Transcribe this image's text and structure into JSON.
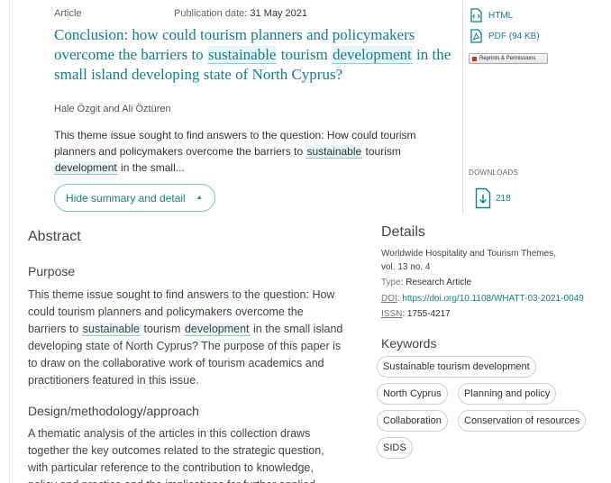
{
  "article": {
    "type": "Article",
    "pub_date_label": "Publication date:",
    "pub_date": "31 May 2021",
    "title_parts": [
      "Conclusion: how could tourism planners and policymakers overcome the barriers to ",
      "sustainable",
      " tourism ",
      "development",
      " in the small island developing state of North Cyprus?"
    ],
    "authors": "Hale Özgit and Ali Öztüren",
    "snippet_parts": [
      "This theme issue sought to find answers to the question: How could tourism planners and policymakers overcome the barriers to ",
      "sustainable",
      " tourism ",
      "development",
      " in the small..."
    ],
    "toggle_label": "Hide summary and detail"
  },
  "sidebar": {
    "html_label": "HTML",
    "pdf_label": "PDF (94 KB)",
    "reprints_label": "Reprints & Permissions",
    "downloads_label": "DOWNLOADS",
    "downloads_count": "218"
  },
  "abstract": {
    "heading": "Abstract",
    "purpose_heading": "Purpose",
    "purpose_parts": [
      "This theme issue sought to find answers to the question: How could tourism planners and policymakers overcome the barriers to ",
      "sustainable",
      " tourism ",
      "development",
      " in the small island developing state of North Cyprus? The purpose of this paper is to draw on the collaborative work of tourism academics and practitioners featured in this issue."
    ],
    "design_heading": "Design/methodology/approach",
    "design_text": "A thematic analysis of the articles in this collection draws together the key outcomes related to the strategic question, with particular reference to the contribution to knowledge, policy and practice and the implications for further applied"
  },
  "details": {
    "heading": "Details",
    "journal": "Worldwide Hospitality and Tourism Themes,",
    "volume": "vol. 13 no. 4",
    "type_label": "Type",
    "type_value": "Research Article",
    "doi_label": "DOI",
    "doi_value": "https://doi.org/10.1108/WHATT-03-2021-0049",
    "issn_label": "ISSN",
    "issn_value": "1755-4217"
  },
  "keywords": {
    "heading": "Keywords",
    "items": [
      "Sustainable tourism development",
      "North Cyprus",
      "Planning and policy",
      "Collaboration",
      "Conservation of resources",
      "SIDS"
    ]
  },
  "colors": {
    "accent": "#127f8d",
    "highlight_bg": "#e6f6f8",
    "highlight_border": "#8ccdd6"
  },
  "icons": [
    "html-file-icon",
    "pdf-file-icon",
    "download-icon",
    "caret-up-icon"
  ]
}
